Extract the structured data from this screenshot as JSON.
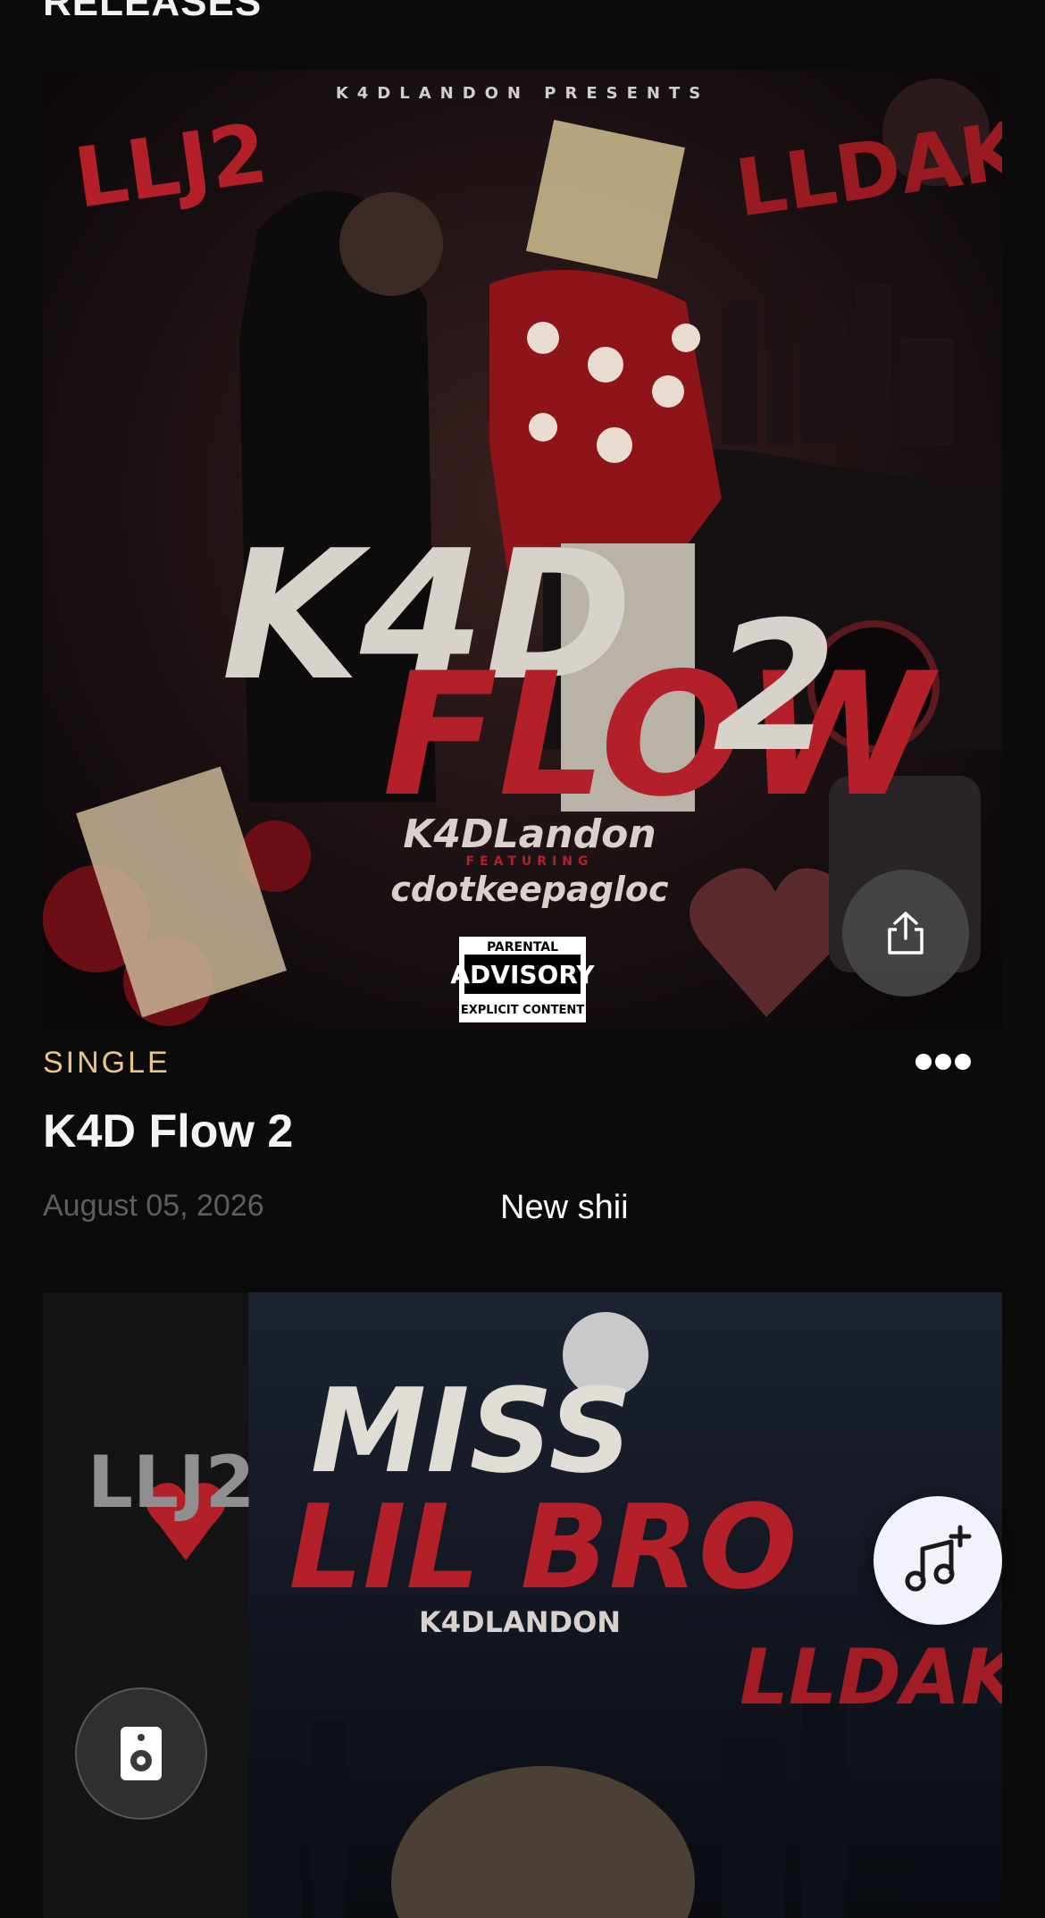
{
  "section": {
    "title": "RELEASES"
  },
  "release1": {
    "kind": "SINGLE",
    "title": "K4D Flow 2",
    "date": "August 05, 2026",
    "caption": "New shii",
    "cover": {
      "presents": "K4DLANDON PRESENTS",
      "tag_left": "LLJ2",
      "tag_right": "LLDAK",
      "title_a": "K4D",
      "title_b": "FLOW",
      "title_num": "2",
      "artist": "K4DLandon",
      "featuring": "FEATURING",
      "feature_artist": "cdotkeepagloc",
      "advisory_top": "PARENTAL",
      "advisory_mid": "ADVISORY",
      "advisory_bottom": "EXPLICIT CONTENT"
    }
  },
  "release2": {
    "cover": {
      "title_a": "MISS",
      "title_b": "LIL BRO",
      "artist": "K4DLANDON",
      "tag_left": "LLJ2",
      "tag_right": "LLDAK"
    }
  },
  "icons": {
    "share": "share-icon",
    "more": "more-dots-icon",
    "music": "music-add-icon",
    "speaker": "speaker-icon"
  },
  "colors": {
    "accent": "#e7c587",
    "art_red": "#b3202a"
  }
}
